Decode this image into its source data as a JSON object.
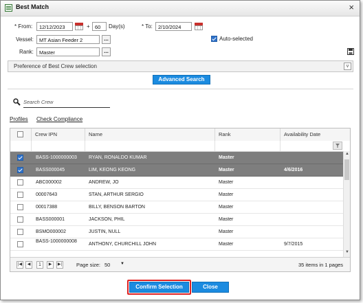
{
  "window": {
    "title": "Best Match"
  },
  "form": {
    "from_label": "* From:",
    "from_value": "12/12/2023",
    "plus_sign": "+",
    "days_value": "60",
    "days_unit": "Day(s)",
    "to_label": "* To:",
    "to_value": "2/10/2024",
    "vessel_label": "Vessel:",
    "vessel_value": "MT Asian Feeder 2",
    "auto_selected_label": "Auto-selected",
    "auto_selected_checked": true,
    "rank_label": "Rank:",
    "rank_value": "Master",
    "browse_label": "..."
  },
  "preference": {
    "label": "Preference of Best Crew selection"
  },
  "advanced_search_label": "Advanced Search",
  "search": {
    "placeholder": "Search Crew"
  },
  "links": {
    "profiles": "Profiles",
    "check_compliance": "Check Compliance"
  },
  "grid": {
    "columns": [
      "Crew IPN",
      "Name",
      "Rank",
      "Availability Date"
    ],
    "rows": [
      {
        "ipn": "BASS-1000000003",
        "name": "RYAN, RONALDO KUMAR",
        "rank": "Master",
        "date": "",
        "checked": true,
        "selected": true
      },
      {
        "ipn": "BASS000045",
        "name": "LIM, KEONG KEONG",
        "rank": "Master",
        "date": "4/6/2016",
        "checked": true,
        "selected": true
      },
      {
        "ipn": "ABC000002",
        "name": "ANDREW, JO",
        "rank": "Master",
        "date": "",
        "checked": false,
        "selected": false
      },
      {
        "ipn": "00007643",
        "name": "STAN, ARTHUR SERGIO",
        "rank": "Master",
        "date": "",
        "checked": false,
        "selected": false
      },
      {
        "ipn": "00017388",
        "name": "BILLY, BENSON BARTON",
        "rank": "Master",
        "date": "",
        "checked": false,
        "selected": false
      },
      {
        "ipn": "BASS000001",
        "name": "JACKSON, PHIL",
        "rank": "Master",
        "date": "",
        "checked": false,
        "selected": false
      },
      {
        "ipn": "BSMO000002",
        "name": "JUSTIN, NULL",
        "rank": "Master",
        "date": "",
        "checked": false,
        "selected": false
      },
      {
        "ipn": "BASS-1000000008",
        "name": "ANTHONY, CHURCHILL JOHN",
        "rank": "Master",
        "date": "9/7/2015",
        "checked": false,
        "selected": false
      }
    ]
  },
  "pager": {
    "current_page": "1",
    "page_size_label": "Page size:",
    "page_size_value": "50",
    "summary": "35 items in 1 pages"
  },
  "buttons": {
    "confirm": "Confirm Selection",
    "close": "Close"
  },
  "colors": {
    "accent_blue": "#1b8be0",
    "highlight_red": "#e02020",
    "selected_row": "#7e7e7e"
  }
}
